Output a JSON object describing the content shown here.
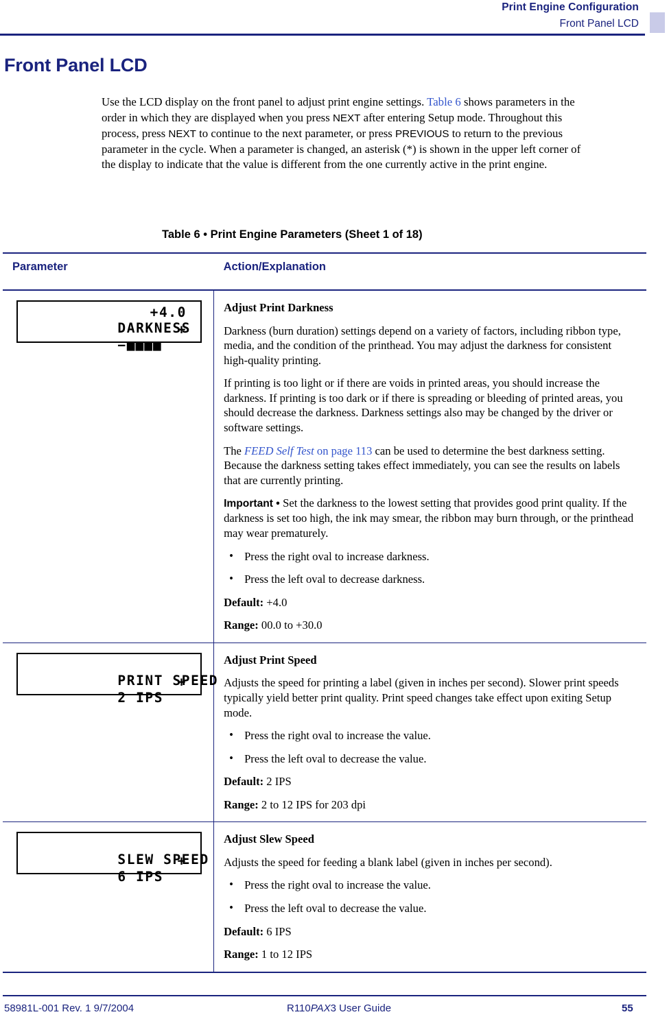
{
  "header": {
    "line1": "Print Engine Configuration",
    "line2": "Front Panel LCD"
  },
  "title": "Front Panel LCD",
  "intro": {
    "part1": "Use the LCD display on the front panel to adjust print engine settings. ",
    "link1": "Table 6",
    "part2": " shows parameters in the order in which they are displayed when you press ",
    "key1": "NEXT",
    "part3": " after entering Setup mode. Throughout this process, press ",
    "key2": "NEXT",
    "part4": " to continue to the next parameter, or press ",
    "key3": "PREVIOUS",
    "part5": " to return to the previous parameter in the cycle. When a parameter is changed, an asterisk (*) is shown in the upper left corner of the display to indicate that the value is different from the one currently active in the print engine."
  },
  "table_caption": "Table 6 • Print Engine Parameters (Sheet 1 of 18)",
  "table": {
    "headers": {
      "parameter": "Parameter",
      "action": "Action/Explanation"
    },
    "rows": [
      {
        "lcd": {
          "line1_left": "DARKNESS",
          "line1_right": "+4.0",
          "line2_left": "−",
          "line2_bars": "■■■■",
          "line2_right": "+"
        },
        "heading": "Adjust Print Darkness",
        "p1": "Darkness (burn duration) settings depend on a variety of factors, including ribbon type, media, and the condition of the printhead. You may adjust the darkness for consistent high-quality printing.",
        "p2": "If printing is too light or if there are voids in printed areas, you should increase the darkness. If printing is too dark or if there is spreading or bleeding of printed areas, you should decrease the darkness. Darkness settings also may be changed by the driver or software settings.",
        "p3_pre": "The ",
        "p3_link_ital": "FEED Self Test",
        "p3_link_rest": " on page 113",
        "p3_post": " can be used to determine the best darkness setting. Because the darkness setting takes effect immediately, you can see the results on labels that are currently printing.",
        "important_label": "Important • ",
        "important_text": "Set the darkness to the lowest setting that provides good print quality. If the darkness is set too high, the ink may smear, the ribbon may burn through, or the printhead may wear prematurely.",
        "bullet1": "Press the right oval to increase darkness.",
        "bullet2": "Press the left oval to decrease darkness.",
        "default_label": "Default:",
        "default_value": " +4.0",
        "range_label": "Range:",
        "range_value": " 00.0 to +30.0"
      },
      {
        "lcd": {
          "line1_left": "PRINT SPEED",
          "line1_right": "",
          "line2_left": "2 IPS",
          "line2_bars": "",
          "line2_right": "+"
        },
        "heading": "Adjust Print Speed",
        "p1": "Adjusts the speed for printing a label (given in inches per second). Slower print speeds typically yield better print quality. Print speed changes take effect upon exiting Setup mode.",
        "bullet1": "Press the right oval to increase the value.",
        "bullet2": "Press the left oval to decrease the value.",
        "default_label": "Default:",
        "default_value": " 2 IPS",
        "range_label": "Range:",
        "range_value": " 2 to 12 IPS for 203 dpi"
      },
      {
        "lcd": {
          "line1_left": "SLEW SPEED",
          "line1_right": "",
          "line2_left": "6 IPS",
          "line2_bars": "",
          "line2_right": "+"
        },
        "heading": "Adjust Slew Speed",
        "p1": "Adjusts the speed for feeding a blank label (given in inches per second).",
        "bullet1": "Press the right oval to increase the value.",
        "bullet2": "Press the left oval to decrease the value.",
        "default_label": "Default:",
        "default_value": " 6 IPS",
        "range_label": "Range:",
        "range_value": " 1 to 12 IPS"
      }
    ]
  },
  "footer": {
    "left": "58981L-001 Rev. 1    9/7/2004",
    "center_pre": "R110",
    "center_ital": "PAX",
    "center_post": "3 User Guide",
    "page": "55"
  }
}
